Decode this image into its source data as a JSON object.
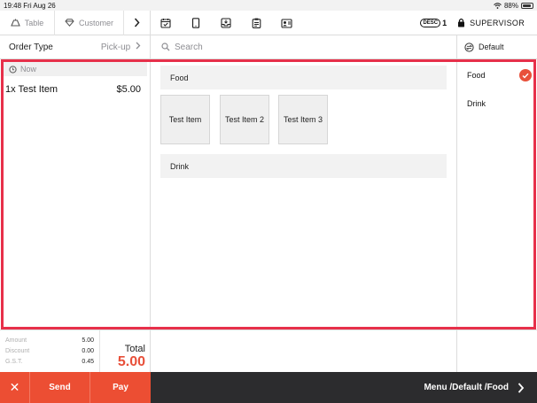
{
  "status_bar": {
    "time": "19:48",
    "date": "Fri Aug 26",
    "battery": "88%"
  },
  "toolbar": {
    "table_label": "Table",
    "customer_label": "Customer",
    "desc_badge": "DESC",
    "desc_count": "1",
    "user_label": "SUPERVISOR"
  },
  "order": {
    "type_label": "Order Type",
    "type_value": "Pick-up",
    "time_label": "Now",
    "lines": [
      {
        "text": "1x Test Item",
        "price": "$5.00"
      }
    ]
  },
  "search": {
    "placeholder": "Search"
  },
  "menu_selector": {
    "label": "Default"
  },
  "menu": {
    "sections": [
      {
        "name": "Food",
        "items": [
          "Test  Item",
          "Test  Item 2",
          "Test  Item 3"
        ]
      },
      {
        "name": "Drink",
        "items": []
      }
    ]
  },
  "categories": [
    {
      "name": "Food",
      "selected": true
    },
    {
      "name": "Drink",
      "selected": false
    }
  ],
  "totals": {
    "amount_label": "Amount",
    "amount": "5.00",
    "discount_label": "Discount",
    "discount": "0.00",
    "gst_label": "G.S.T.",
    "gst": "0.45",
    "total_label": "Total",
    "total": "5.00"
  },
  "actions": {
    "send": "Send",
    "pay": "Pay",
    "cancel_symbol": "✕"
  },
  "breadcrumb": "Menu /Default /Food",
  "colors": {
    "accent": "#ec4e33",
    "highlight": "#e7304a",
    "nav": "#2c2c2e"
  }
}
